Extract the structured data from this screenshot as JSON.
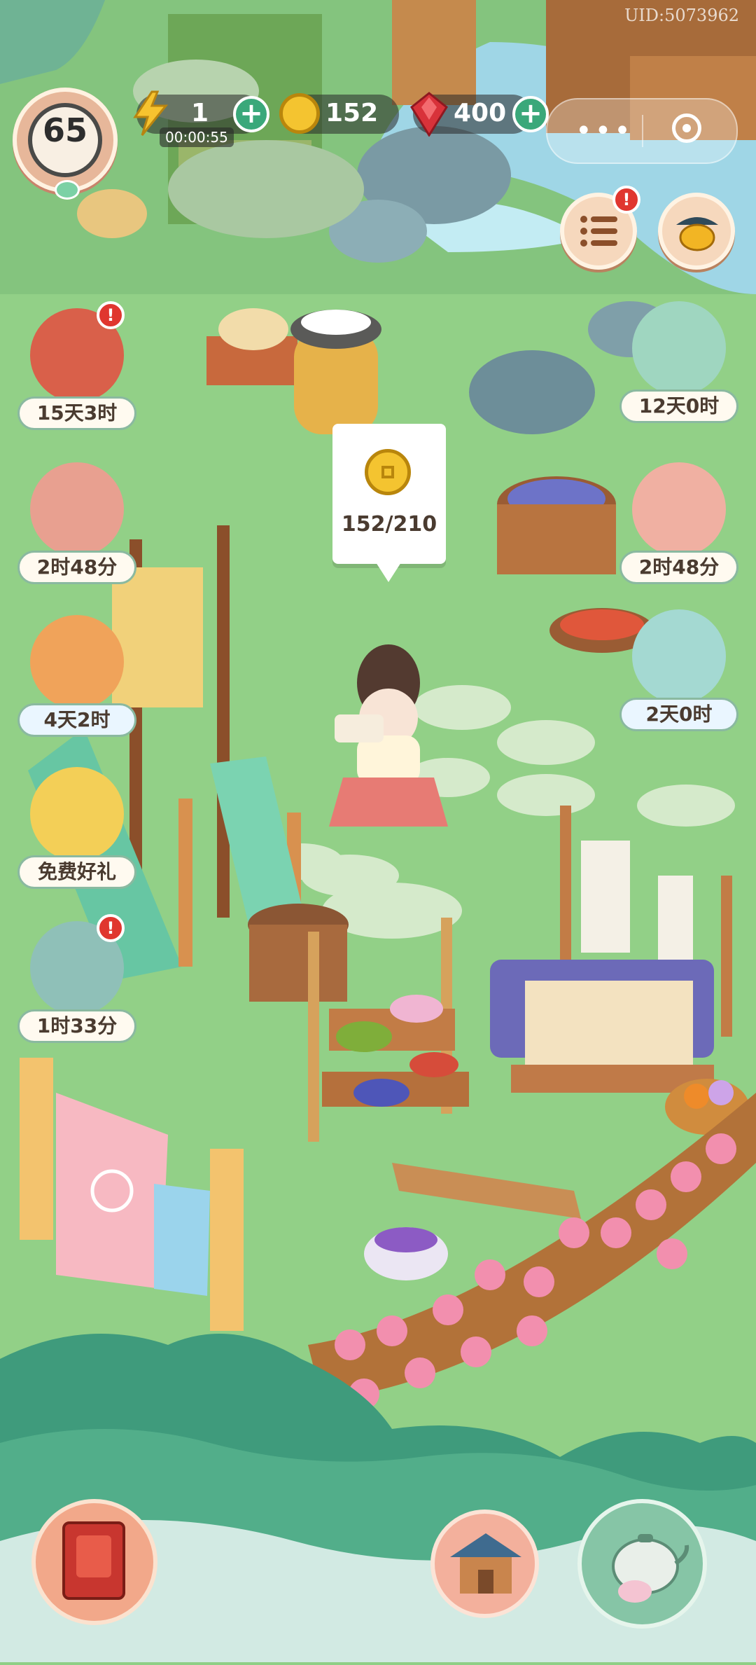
{
  "uid": "UID:5073962",
  "hud": {
    "level": "65",
    "energy": "1",
    "energy_timer": "00:00:55",
    "coins": "152",
    "gems": "400"
  },
  "coin_bubble": {
    "text": "152/210"
  },
  "left_events": [
    {
      "name": "event-book",
      "label": "15天3时",
      "badge": "!"
    },
    {
      "name": "event-monkey",
      "label": "2时48分"
    },
    {
      "name": "event-maple-bowl",
      "label": "4天2时"
    },
    {
      "name": "event-free-gift",
      "label": "免费好礼"
    },
    {
      "name": "event-swordsman",
      "label": "1时33分",
      "badge": "!"
    }
  ],
  "right_events": [
    {
      "name": "event-cat-lotus",
      "label": "12天0时"
    },
    {
      "name": "event-tiger",
      "label": "2时48分"
    },
    {
      "name": "event-cat-gift",
      "label": "2天0时"
    }
  ],
  "colors": {
    "accent_green": "#3aa87a",
    "badge_red": "#e0362f",
    "coin_gold": "#f4c430",
    "gem_red": "#d8323a"
  }
}
